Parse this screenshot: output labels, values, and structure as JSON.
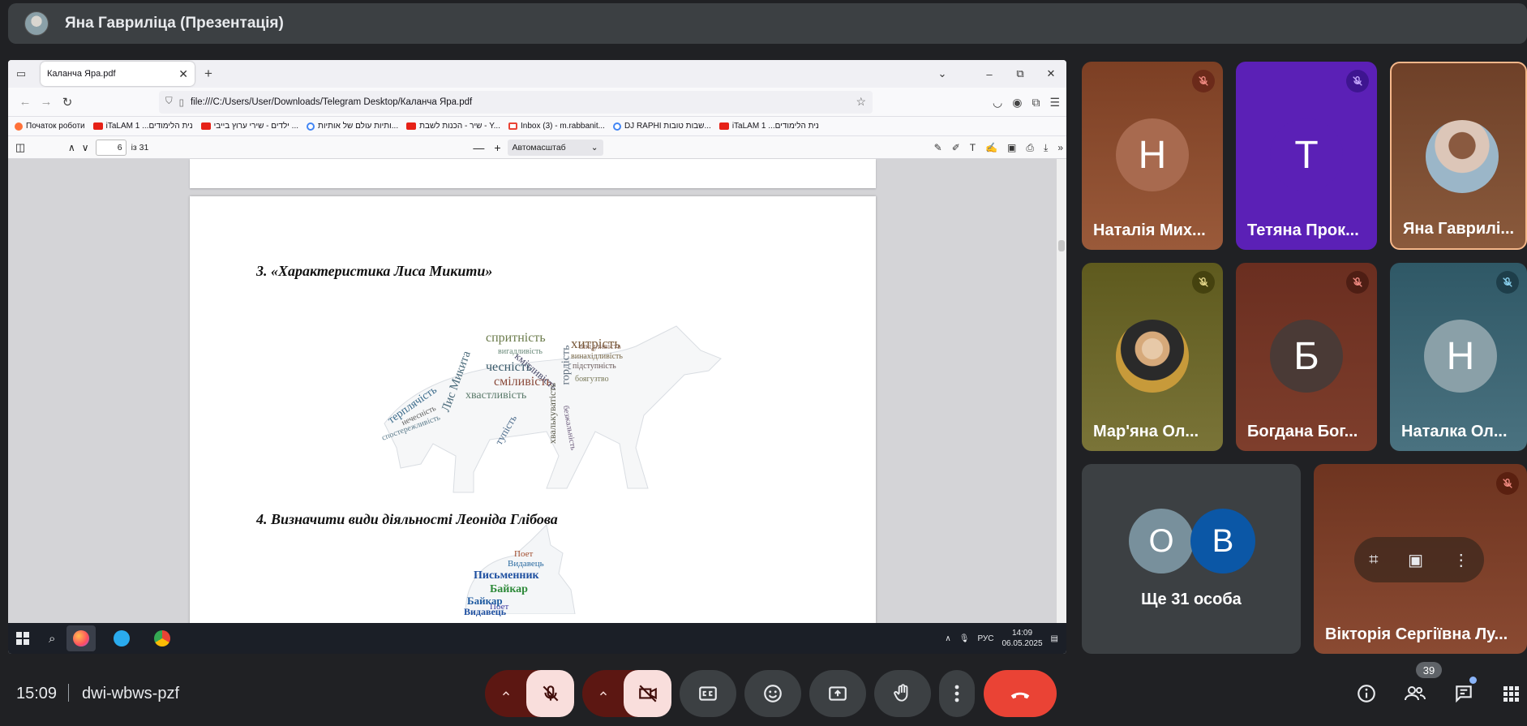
{
  "presenter": {
    "title": "Яна Гавриліца (Презентація)"
  },
  "browser": {
    "tab_title": "Каланча Яра.pdf",
    "url": "file:///C:/Users/User/Downloads/Telegram Desktop/Каланча Яра.pdf",
    "bookmarks": [
      {
        "label": "Початок роботи",
        "icon": "firefox"
      },
      {
        "label": "iTaLAM 1 ...נית הלימודים",
        "icon": "youtube"
      },
      {
        "label": "ילדים - שירי ערוץ בייבי ...",
        "icon": "youtube"
      },
      {
        "label": "ותיות עולם של אותיות...",
        "icon": "google"
      },
      {
        "label": "שיר - הכנות לשבת - Y...",
        "icon": "youtube"
      },
      {
        "label": "Inbox (3) - m.rabbanit...",
        "icon": "gmail"
      },
      {
        "label": "DJ RAPHI שבות טובות...",
        "icon": "google"
      },
      {
        "label": "iTaLAM 1 ...נית הלימודים",
        "icon": "youtube"
      }
    ]
  },
  "pdf": {
    "page_current": "6",
    "page_total": "із 31",
    "scale": "Автомасштаб",
    "heading3": "3.  «Характеристика Лиса Микити»",
    "heading4": "4.  Визначити види діяльності Леоніда Глібова",
    "fox_words": [
      "хитрість",
      "чесність",
      "спритність",
      "сміливість",
      "терплячість",
      "Лис Микита",
      "спостережливість",
      "хвастливість",
      "винахідливість",
      "підступність",
      "кмітливість",
      "гордість",
      "боягузтво",
      "вигадливість",
      "тупість",
      "хвалькуватість",
      "безжальність",
      "шкідливість",
      "нечесність"
    ],
    "cat_words": [
      "Письменник",
      "Байкар",
      "Поет",
      "Видавець",
      "Поет",
      "Байкар",
      "Видавець"
    ]
  },
  "taskbar": {
    "lang": "РУС",
    "time": "14:09",
    "date": "06.05.2025"
  },
  "participants": [
    {
      "name": "Наталія Мих...",
      "initial": "Н",
      "bg": "#8a4a2c",
      "avatar_bg": "#a86a4f",
      "muted": true
    },
    {
      "name": "Тетяна Прок...",
      "initial": "Т",
      "bg": "#5a22b8",
      "avatar_bg": "#5a22b8",
      "muted": true
    },
    {
      "name": "Яна Гаврилі...",
      "initial": "",
      "bg": "#7a4a30",
      "muted": false,
      "photo": true
    },
    {
      "name": "Мар'яна Ол...",
      "initial": "",
      "bg": "#6a6a2a",
      "muted": true,
      "photo": true
    },
    {
      "name": "Богдана Бог...",
      "initial": "Б",
      "bg": "#6a3024",
      "avatar_bg": "#4a4040",
      "muted": true
    },
    {
      "name": "Наталка Ол...",
      "initial": "Н",
      "bg": "#3e5e6a",
      "avatar_bg": "#8aa0a8",
      "muted": true
    }
  ],
  "others": {
    "label": "Ще 31 особа",
    "initials": [
      "О",
      "В"
    ]
  },
  "pinned": {
    "name": "Вікторія Сергіївна Лу..."
  },
  "meeting": {
    "time": "15:09",
    "code": "dwi-wbws-pzf",
    "people_count": "39"
  }
}
